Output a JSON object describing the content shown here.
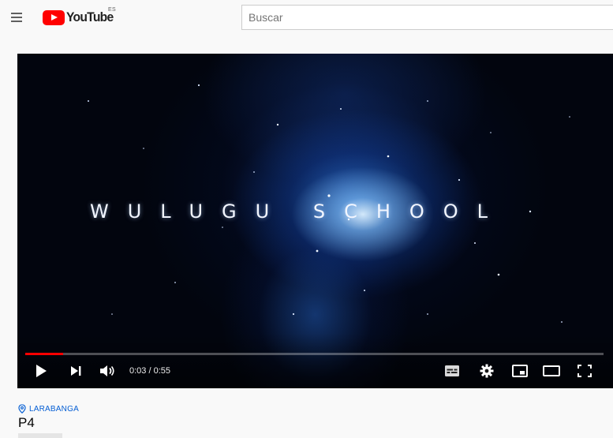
{
  "masthead": {
    "logo_text": "YouTube",
    "country_code": "ES",
    "search_placeholder": "Buscar"
  },
  "player": {
    "overlay_text": "WULUGU SCHOOL",
    "current_time": "0:03",
    "separator": " / ",
    "duration": "0:55",
    "progress_fraction": 0.066,
    "accent_color": "#ff0000",
    "controls": [
      "play-icon",
      "next-icon",
      "volume-icon",
      "subtitles-icon",
      "settings-icon",
      "miniplayer-icon",
      "theater-mode-icon",
      "fullscreen-icon"
    ]
  },
  "video": {
    "location": "LARABANGA",
    "title": "P4"
  }
}
